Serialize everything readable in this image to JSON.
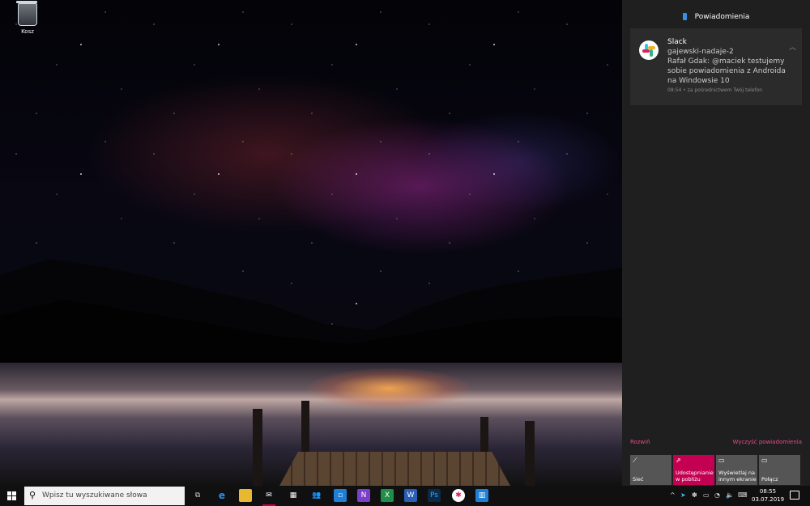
{
  "desktop": {
    "icons": [
      {
        "label": "Kosz",
        "icon": "recycle-bin-icon"
      }
    ]
  },
  "action_center": {
    "title": "Powiadomienia",
    "notification": {
      "app": "Slack",
      "channel": "gajewski-nadaje-2",
      "message": "Rafał Gdak: @maciek testujemy sobie powiadomienia z Androida na Windowsie 10",
      "meta": "08:54 • za pośrednictwem Twój telefon"
    },
    "expand_label": "Rozwiń",
    "clear_label": "Wyczyść powiadomienia",
    "quick_actions": [
      {
        "label": "Sieć",
        "icon": "network-icon",
        "active": false
      },
      {
        "label": "Udostępnianie w pobliżu",
        "icon": "nearby-share-icon",
        "active": true
      },
      {
        "label": "Wyświetlaj na innym ekranie",
        "icon": "project-icon",
        "active": false
      },
      {
        "label": "Połącz",
        "icon": "connect-icon",
        "active": false
      }
    ]
  },
  "taskbar": {
    "search_placeholder": "Wpisz tu wyszukiwane słowa",
    "time": "08:55",
    "date": "03.07.2019",
    "accent_color": "#c30052"
  }
}
